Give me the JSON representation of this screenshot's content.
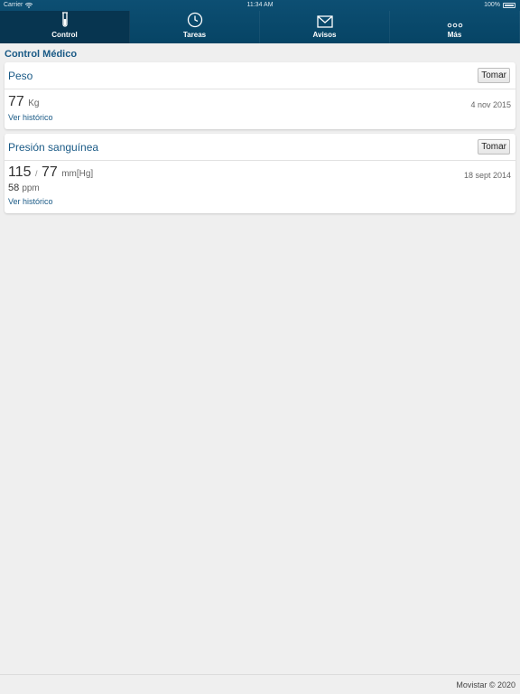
{
  "status_bar": {
    "carrier": "Carrier",
    "time": "11:34 AM",
    "battery": "100%"
  },
  "tabs": [
    {
      "label": "Control",
      "icon": "test-tube-icon",
      "active": true
    },
    {
      "label": "Tareas",
      "icon": "clock-icon",
      "active": false
    },
    {
      "label": "Avisos",
      "icon": "envelope-icon",
      "active": false
    },
    {
      "label": "Más",
      "icon": "more-dots-icon",
      "active": false
    }
  ],
  "section_title": "Control Médico",
  "weight_card": {
    "title": "Peso",
    "button": "Tomar",
    "value": "77",
    "unit": "Kg",
    "date": "4 nov 2015",
    "history_link": "Ver histórico"
  },
  "pressure_card": {
    "title": "Presión sanguínea",
    "button": "Tomar",
    "systolic": "115",
    "separator": "/",
    "diastolic": "77",
    "unit": "mm[Hg]",
    "pulse": "58",
    "pulse_unit": "ppm",
    "date": "18 sept 2014",
    "history_link": "Ver histórico"
  },
  "footer": {
    "copyright": "Movistar © 2020"
  },
  "colors": {
    "nav_background": "#0d4f73",
    "nav_active": "#073550",
    "accent_text": "#1a5a86",
    "page_background": "#efefef"
  }
}
